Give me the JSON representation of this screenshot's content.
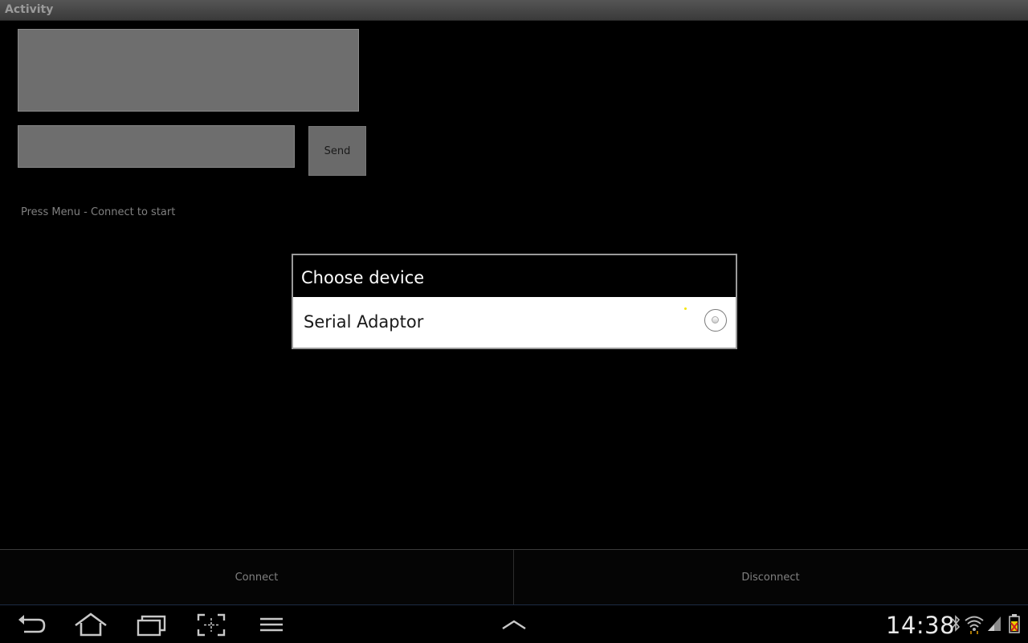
{
  "window": {
    "title": "Activity"
  },
  "main": {
    "output_text": "",
    "message_value": "",
    "send_label": "Send",
    "status_text": "Press Menu - Connect to start"
  },
  "dialog": {
    "title": "Choose device",
    "options": [
      {
        "label": "Serial Adaptor",
        "selected": false
      }
    ]
  },
  "menu": {
    "connect_label": "Connect",
    "disconnect_label": "Disconnect"
  },
  "system_bar": {
    "time": "14:38",
    "icons": [
      "back-icon",
      "home-icon",
      "recent-apps-icon",
      "screenshot-icon",
      "menu-icon",
      "up-arrow-icon",
      "bluetooth-icon",
      "wifi-icon",
      "signal-icon",
      "battery-icon"
    ]
  }
}
